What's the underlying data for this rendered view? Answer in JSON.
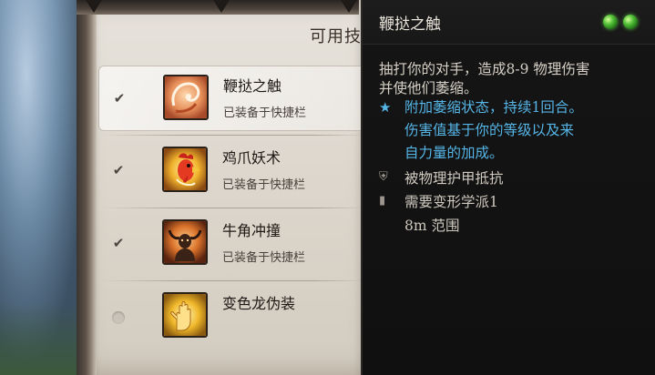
{
  "panel": {
    "section_title": "可用技",
    "skills": [
      {
        "name": "鞭挞之触",
        "status": "已装备于快捷栏",
        "checked": true,
        "selected": true,
        "icon": "touch-tendril-icon"
      },
      {
        "name": "鸡爪妖术",
        "status": "已装备于快捷栏",
        "checked": true,
        "selected": false,
        "icon": "chicken-head-icon"
      },
      {
        "name": "牛角冲撞",
        "status": "已装备于快捷栏",
        "checked": true,
        "selected": false,
        "icon": "horned-head-icon"
      },
      {
        "name": "变色龙伪装",
        "status": "",
        "checked": false,
        "selected": false,
        "icon": "glowing-hand-icon"
      }
    ]
  },
  "tooltip": {
    "title": "鞭挞之触",
    "action_points": 2,
    "description_line1": "抽打你的对手，造成8-9 物理伤害",
    "description_line2": "并使他们萎缩。",
    "effect_line1": "附加萎缩状态，持续1回合。",
    "effect_line2": "伤害值基于你的等级以及来",
    "effect_line3": "自力量的加成。",
    "props": [
      {
        "icon": "shield-icon",
        "text": "被物理护甲抵抗"
      },
      {
        "icon": "bookmark-icon",
        "text": "需要变形学派1"
      },
      {
        "icon": "",
        "text": "8m 范围"
      }
    ]
  },
  "colors": {
    "effect_blue": "#55b5e6",
    "ap_green": "#55c23a",
    "parchment": "#dcd6cc"
  }
}
